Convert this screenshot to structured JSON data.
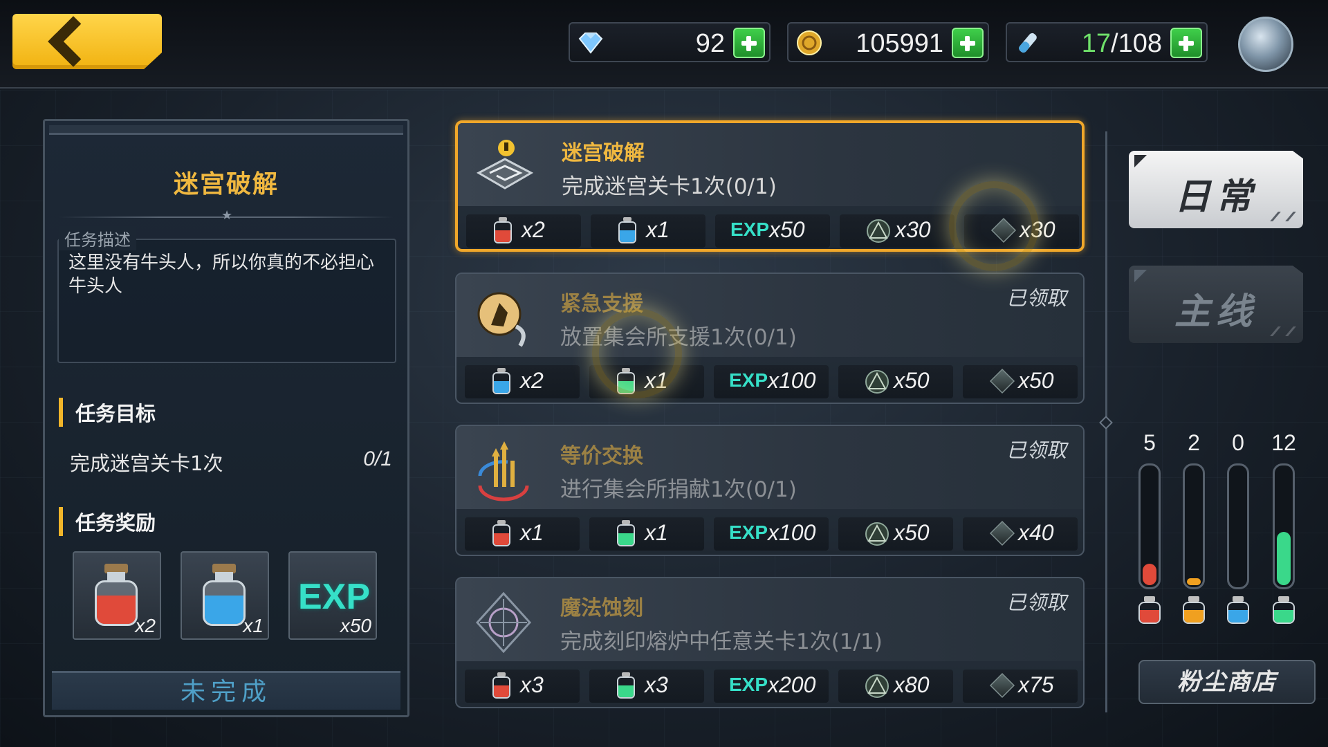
{
  "topbar": {
    "gems": "92",
    "gold": "105991",
    "stamina_current": "17",
    "stamina_max": "/108"
  },
  "detail": {
    "title": "迷宫破解",
    "desc_label": "任务描述",
    "desc_text": "这里没有牛头人，所以你真的不必担心牛头人",
    "goal_header": "任务目标",
    "goal_text": "完成迷宫关卡1次",
    "goal_progress": "0/1",
    "reward_header": "任务奖励",
    "rewards": [
      {
        "icon": "red-potion-icon",
        "qty": "x2",
        "color": "#e04a3a"
      },
      {
        "icon": "blue-potion-icon",
        "qty": "x1",
        "color": "#3aa6e8"
      },
      {
        "icon": "exp-icon",
        "label": "EXP",
        "qty": "x50"
      }
    ],
    "status_button": "未完成"
  },
  "quests": [
    {
      "title": "迷宫破解",
      "desc": "完成迷宫关卡1次(0/1)",
      "status": "",
      "icon": "maze-icon",
      "rewards": [
        {
          "icon": "red-potion-icon",
          "qty": "x2",
          "color": "#e04a3a"
        },
        {
          "icon": "blue-potion-icon",
          "qty": "x1",
          "color": "#3aa6e8"
        },
        {
          "icon": "exp-icon",
          "label": "EXP",
          "qty": "x50"
        },
        {
          "icon": "emblem-icon",
          "qty": "x30"
        },
        {
          "icon": "dust-icon",
          "qty": "x30"
        }
      ]
    },
    {
      "title": "紧急支援",
      "desc": "放置集会所支援1次(0/1)",
      "status": "已领取",
      "icon": "support-icon",
      "rewards": [
        {
          "icon": "blue-potion-icon",
          "qty": "x2",
          "color": "#3aa6e8"
        },
        {
          "icon": "green-potion-icon",
          "qty": "x1",
          "color": "#3ad88a"
        },
        {
          "icon": "exp-icon",
          "label": "EXP",
          "qty": "x100"
        },
        {
          "icon": "emblem-icon",
          "qty": "x50"
        },
        {
          "icon": "dust-icon",
          "qty": "x50"
        }
      ]
    },
    {
      "title": "等价交换",
      "desc": "进行集会所捐献1次(0/1)",
      "status": "已领取",
      "icon": "exchange-icon",
      "rewards": [
        {
          "icon": "red-potion-icon",
          "qty": "x1",
          "color": "#e04a3a"
        },
        {
          "icon": "green-potion-icon",
          "qty": "x1",
          "color": "#3ad88a"
        },
        {
          "icon": "exp-icon",
          "label": "EXP",
          "qty": "x100"
        },
        {
          "icon": "emblem-icon",
          "qty": "x50"
        },
        {
          "icon": "dust-icon",
          "qty": "x40"
        }
      ]
    },
    {
      "title": "魔法蚀刻",
      "desc": "完成刻印熔炉中任意关卡1次(1/1)",
      "status": "已领取",
      "icon": "magic-etch-icon",
      "rewards": [
        {
          "icon": "red-potion-icon",
          "qty": "x3",
          "color": "#e04a3a"
        },
        {
          "icon": "green-potion-icon",
          "qty": "x3",
          "color": "#3ad88a"
        },
        {
          "icon": "exp-icon",
          "label": "EXP",
          "qty": "x200"
        },
        {
          "icon": "emblem-icon",
          "qty": "x80"
        },
        {
          "icon": "dust-icon",
          "qty": "x75"
        }
      ]
    }
  ],
  "tabs": {
    "daily": "日常",
    "main": "主线"
  },
  "gauges": [
    {
      "value": "5",
      "fill": 0.18,
      "color": "#e04a3a",
      "icon": "red-potion-icon"
    },
    {
      "value": "2",
      "fill": 0.06,
      "color": "#f0a020",
      "icon": "orange-potion-icon"
    },
    {
      "value": "0",
      "fill": 0.0,
      "color": "#3aa6e8",
      "icon": "blue-potion-icon"
    },
    {
      "value": "12",
      "fill": 0.45,
      "color": "#3ad88a",
      "icon": "green-potion-icon"
    }
  ],
  "shop_label": "粉尘商店"
}
